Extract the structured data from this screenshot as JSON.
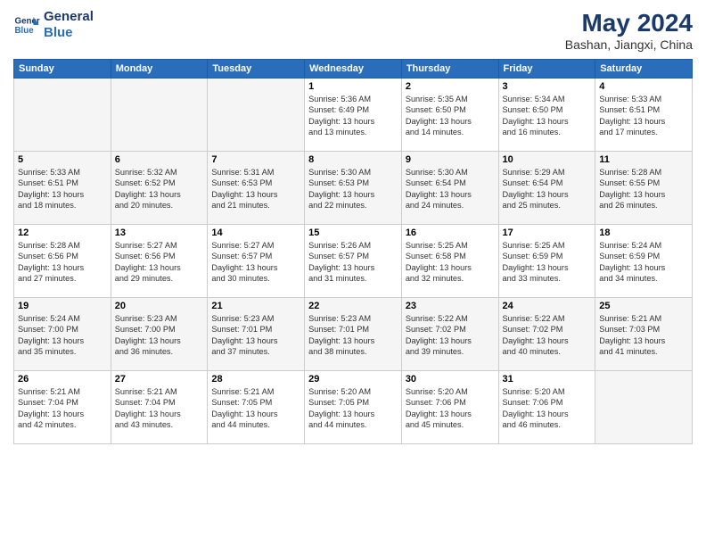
{
  "header": {
    "logo_line1": "General",
    "logo_line2": "Blue",
    "month_year": "May 2024",
    "location": "Bashan, Jiangxi, China"
  },
  "days_of_week": [
    "Sunday",
    "Monday",
    "Tuesday",
    "Wednesday",
    "Thursday",
    "Friday",
    "Saturday"
  ],
  "weeks": [
    [
      {
        "day": "",
        "info": ""
      },
      {
        "day": "",
        "info": ""
      },
      {
        "day": "",
        "info": ""
      },
      {
        "day": "1",
        "info": "Sunrise: 5:36 AM\nSunset: 6:49 PM\nDaylight: 13 hours\nand 13 minutes."
      },
      {
        "day": "2",
        "info": "Sunrise: 5:35 AM\nSunset: 6:50 PM\nDaylight: 13 hours\nand 14 minutes."
      },
      {
        "day": "3",
        "info": "Sunrise: 5:34 AM\nSunset: 6:50 PM\nDaylight: 13 hours\nand 16 minutes."
      },
      {
        "day": "4",
        "info": "Sunrise: 5:33 AM\nSunset: 6:51 PM\nDaylight: 13 hours\nand 17 minutes."
      }
    ],
    [
      {
        "day": "5",
        "info": "Sunrise: 5:33 AM\nSunset: 6:51 PM\nDaylight: 13 hours\nand 18 minutes."
      },
      {
        "day": "6",
        "info": "Sunrise: 5:32 AM\nSunset: 6:52 PM\nDaylight: 13 hours\nand 20 minutes."
      },
      {
        "day": "7",
        "info": "Sunrise: 5:31 AM\nSunset: 6:53 PM\nDaylight: 13 hours\nand 21 minutes."
      },
      {
        "day": "8",
        "info": "Sunrise: 5:30 AM\nSunset: 6:53 PM\nDaylight: 13 hours\nand 22 minutes."
      },
      {
        "day": "9",
        "info": "Sunrise: 5:30 AM\nSunset: 6:54 PM\nDaylight: 13 hours\nand 24 minutes."
      },
      {
        "day": "10",
        "info": "Sunrise: 5:29 AM\nSunset: 6:54 PM\nDaylight: 13 hours\nand 25 minutes."
      },
      {
        "day": "11",
        "info": "Sunrise: 5:28 AM\nSunset: 6:55 PM\nDaylight: 13 hours\nand 26 minutes."
      }
    ],
    [
      {
        "day": "12",
        "info": "Sunrise: 5:28 AM\nSunset: 6:56 PM\nDaylight: 13 hours\nand 27 minutes."
      },
      {
        "day": "13",
        "info": "Sunrise: 5:27 AM\nSunset: 6:56 PM\nDaylight: 13 hours\nand 29 minutes."
      },
      {
        "day": "14",
        "info": "Sunrise: 5:27 AM\nSunset: 6:57 PM\nDaylight: 13 hours\nand 30 minutes."
      },
      {
        "day": "15",
        "info": "Sunrise: 5:26 AM\nSunset: 6:57 PM\nDaylight: 13 hours\nand 31 minutes."
      },
      {
        "day": "16",
        "info": "Sunrise: 5:25 AM\nSunset: 6:58 PM\nDaylight: 13 hours\nand 32 minutes."
      },
      {
        "day": "17",
        "info": "Sunrise: 5:25 AM\nSunset: 6:59 PM\nDaylight: 13 hours\nand 33 minutes."
      },
      {
        "day": "18",
        "info": "Sunrise: 5:24 AM\nSunset: 6:59 PM\nDaylight: 13 hours\nand 34 minutes."
      }
    ],
    [
      {
        "day": "19",
        "info": "Sunrise: 5:24 AM\nSunset: 7:00 PM\nDaylight: 13 hours\nand 35 minutes."
      },
      {
        "day": "20",
        "info": "Sunrise: 5:23 AM\nSunset: 7:00 PM\nDaylight: 13 hours\nand 36 minutes."
      },
      {
        "day": "21",
        "info": "Sunrise: 5:23 AM\nSunset: 7:01 PM\nDaylight: 13 hours\nand 37 minutes."
      },
      {
        "day": "22",
        "info": "Sunrise: 5:23 AM\nSunset: 7:01 PM\nDaylight: 13 hours\nand 38 minutes."
      },
      {
        "day": "23",
        "info": "Sunrise: 5:22 AM\nSunset: 7:02 PM\nDaylight: 13 hours\nand 39 minutes."
      },
      {
        "day": "24",
        "info": "Sunrise: 5:22 AM\nSunset: 7:02 PM\nDaylight: 13 hours\nand 40 minutes."
      },
      {
        "day": "25",
        "info": "Sunrise: 5:21 AM\nSunset: 7:03 PM\nDaylight: 13 hours\nand 41 minutes."
      }
    ],
    [
      {
        "day": "26",
        "info": "Sunrise: 5:21 AM\nSunset: 7:04 PM\nDaylight: 13 hours\nand 42 minutes."
      },
      {
        "day": "27",
        "info": "Sunrise: 5:21 AM\nSunset: 7:04 PM\nDaylight: 13 hours\nand 43 minutes."
      },
      {
        "day": "28",
        "info": "Sunrise: 5:21 AM\nSunset: 7:05 PM\nDaylight: 13 hours\nand 44 minutes."
      },
      {
        "day": "29",
        "info": "Sunrise: 5:20 AM\nSunset: 7:05 PM\nDaylight: 13 hours\nand 44 minutes."
      },
      {
        "day": "30",
        "info": "Sunrise: 5:20 AM\nSunset: 7:06 PM\nDaylight: 13 hours\nand 45 minutes."
      },
      {
        "day": "31",
        "info": "Sunrise: 5:20 AM\nSunset: 7:06 PM\nDaylight: 13 hours\nand 46 minutes."
      },
      {
        "day": "",
        "info": ""
      }
    ]
  ]
}
